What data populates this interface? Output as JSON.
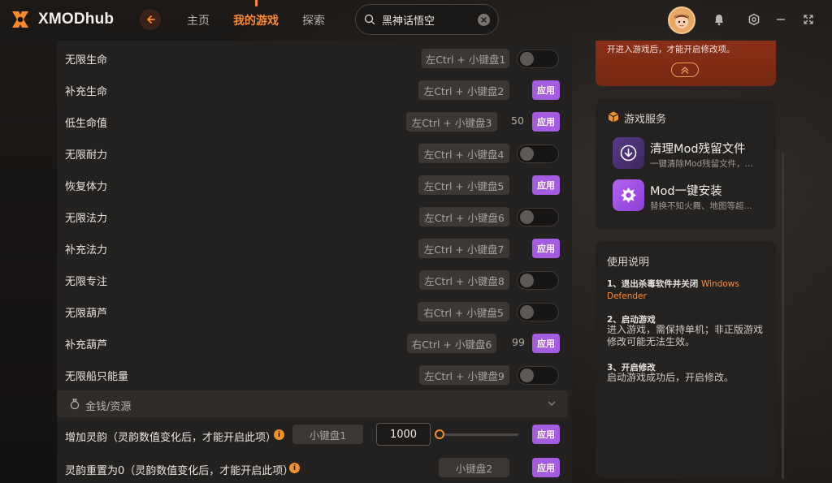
{
  "app": {
    "name": "XMODhub"
  },
  "nav": {
    "home": "主页",
    "my_games": "我的游戏",
    "explore": "探索"
  },
  "search": {
    "value": "黑神话悟空"
  },
  "cheats": [
    {
      "label": "无限生命",
      "hotkey": "左Ctrl + 小键盘1",
      "type": "toggle"
    },
    {
      "label": "补充生命",
      "hotkey": "左Ctrl + 小键盘2",
      "type": "apply"
    },
    {
      "label": "低生命值",
      "hotkey": "左Ctrl + 小键盘3",
      "type": "apply",
      "value": "50"
    },
    {
      "label": "无限耐力",
      "hotkey": "左Ctrl + 小键盘4",
      "type": "toggle"
    },
    {
      "label": "恢复体力",
      "hotkey": "左Ctrl + 小键盘5",
      "type": "apply"
    },
    {
      "label": "无限法力",
      "hotkey": "左Ctrl + 小键盘6",
      "type": "toggle"
    },
    {
      "label": "补充法力",
      "hotkey": "左Ctrl + 小键盘7",
      "type": "apply"
    },
    {
      "label": "无限专注",
      "hotkey": "左Ctrl + 小键盘8",
      "type": "toggle"
    },
    {
      "label": "无限葫芦",
      "hotkey": "右Ctrl + 小键盘5",
      "type": "toggle"
    },
    {
      "label": "补充葫芦",
      "hotkey": "右Ctrl + 小键盘6",
      "type": "apply",
      "value": "99"
    },
    {
      "label": "无限船只能量",
      "hotkey": "左Ctrl + 小键盘9",
      "type": "toggle"
    }
  ],
  "apply_label": "应用",
  "section": {
    "title": "金钱/资源"
  },
  "resource_rows": [
    {
      "label": "增加灵韵（灵韵数值变化后，才能开启此项）",
      "hotkey": "小键盘1",
      "input_value": "1000",
      "info": "i"
    },
    {
      "label": "灵韵重置为0（灵韵数值变化后，才能开启此项）",
      "hotkey": "小键盘2",
      "info": "i"
    }
  ],
  "notice": {
    "text": "开进入游戏后，才能开启修改项。"
  },
  "services": {
    "title": "游戏服务",
    "items": [
      {
        "title": "清理Mod残留文件",
        "desc": "一键清除Mod残留文件，..."
      },
      {
        "title": "Mod一键安装",
        "desc": "替换不知火舞、地图等超..."
      }
    ]
  },
  "help": {
    "title": "使用说明",
    "steps": [
      {
        "num": "1、退出杀毒软件并关闭",
        "highlight": "Windows Defender"
      },
      {
        "num": "2、启动游戏",
        "body": "进入游戏，需保持单机；非正版游戏修改可能无法生效。"
      },
      {
        "num": "3、开启修改",
        "body": "启动游戏成功后，开启修改。"
      }
    ]
  },
  "colors": {
    "accent": "#ff8a2c",
    "apply": "#a65ce0",
    "notice": "#8a2e16"
  }
}
